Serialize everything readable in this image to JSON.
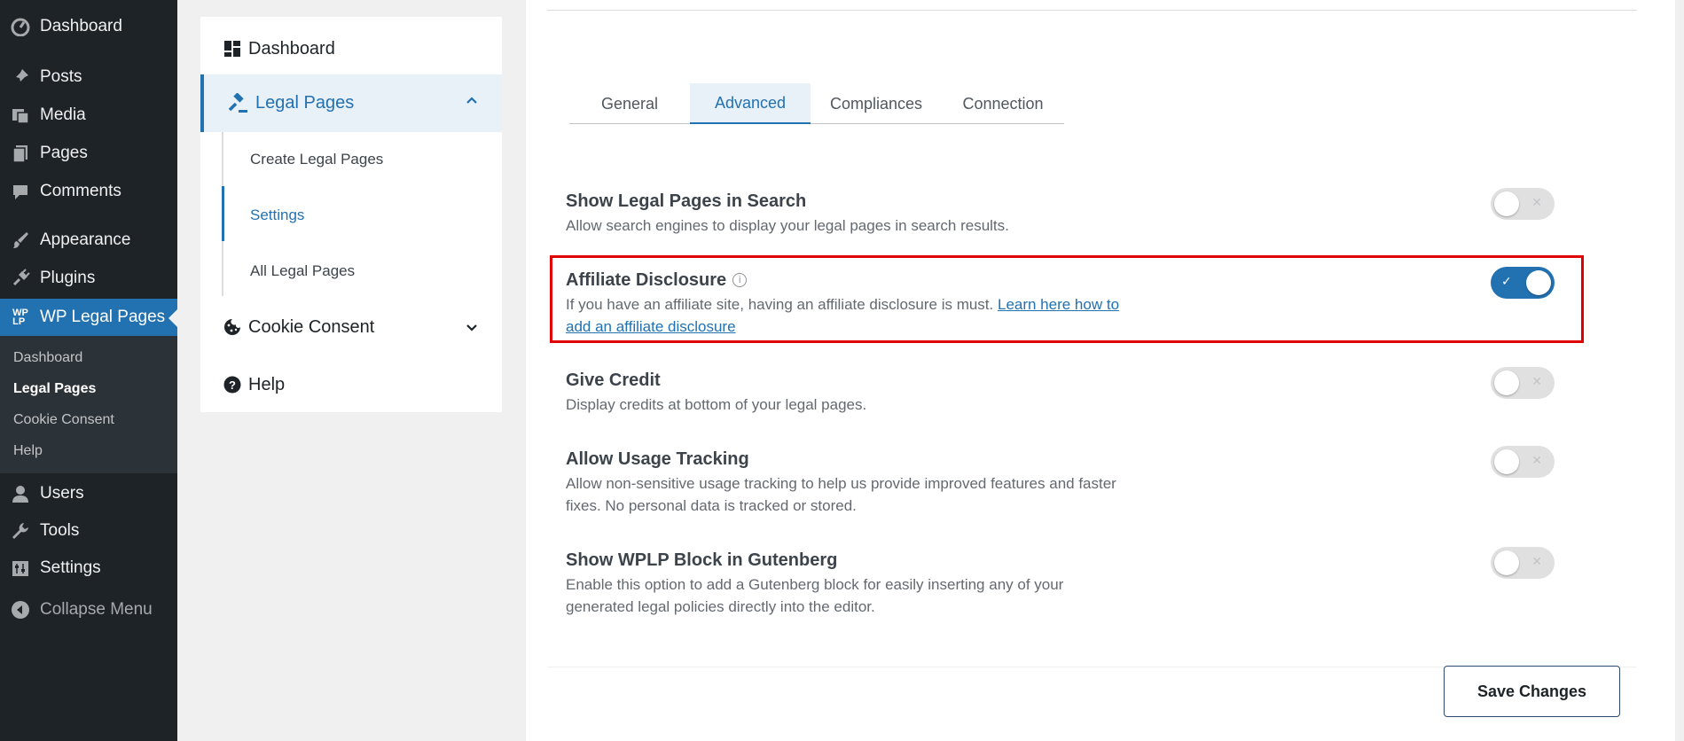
{
  "wp_menu": {
    "items": [
      {
        "label": "Dashboard",
        "icon": "dashboard-icon"
      },
      {
        "label": "Posts",
        "icon": "pin-icon"
      },
      {
        "label": "Media",
        "icon": "media-icon"
      },
      {
        "label": "Pages",
        "icon": "pages-icon"
      },
      {
        "label": "Comments",
        "icon": "comment-icon"
      },
      {
        "label": "Appearance",
        "icon": "brush-icon"
      },
      {
        "label": "Plugins",
        "icon": "plug-icon"
      },
      {
        "label": "WP Legal Pages",
        "icon": "wplp-logo-icon"
      },
      {
        "label": "Users",
        "icon": "user-icon"
      },
      {
        "label": "Tools",
        "icon": "wrench-icon"
      },
      {
        "label": "Settings",
        "icon": "settings-icon"
      },
      {
        "label": "Collapse Menu",
        "icon": "collapse-icon"
      }
    ],
    "wplp_logo_text": "WP\nLP",
    "submenu": [
      "Dashboard",
      "Legal Pages",
      "Cookie Consent",
      "Help"
    ]
  },
  "plugin_nav": {
    "dashboard": "Dashboard",
    "legal_pages": "Legal Pages",
    "legal_sub": [
      "Create Legal Pages",
      "Settings",
      "All Legal Pages"
    ],
    "cookie_consent": "Cookie Consent",
    "help": "Help"
  },
  "tabs": [
    "General",
    "Advanced",
    "Compliances",
    "Connection"
  ],
  "settings": [
    {
      "title": "Show Legal Pages in Search",
      "desc": "Allow search engines to display your legal pages in search results.",
      "enabled": false
    },
    {
      "title": "Affiliate Disclosure",
      "desc_prefix": "If you have an affiliate site, having an affiliate disclosure is must. ",
      "link_a": "Learn here how to",
      "link_b": "add an affiliate disclosure",
      "enabled": true
    },
    {
      "title": "Give Credit",
      "desc": "Display credits at bottom of your legal pages.",
      "enabled": false
    },
    {
      "title": "Allow Usage Tracking",
      "desc_line1": "Allow non-sensitive usage tracking to help us provide improved features and faster",
      "desc_line2": "fixes. No personal data is tracked or stored.",
      "enabled": false
    },
    {
      "title": "Show WPLP Block in Gutenberg",
      "desc_line1": "Enable this option to add a Gutenberg block for easily inserting any of your",
      "desc_line2": "generated legal policies directly into the editor.",
      "enabled": false
    }
  ],
  "save_button": "Save Changes",
  "colors": {
    "accent": "#2271b1",
    "highlight": "#e00000",
    "admin_bg": "#1d2327"
  }
}
